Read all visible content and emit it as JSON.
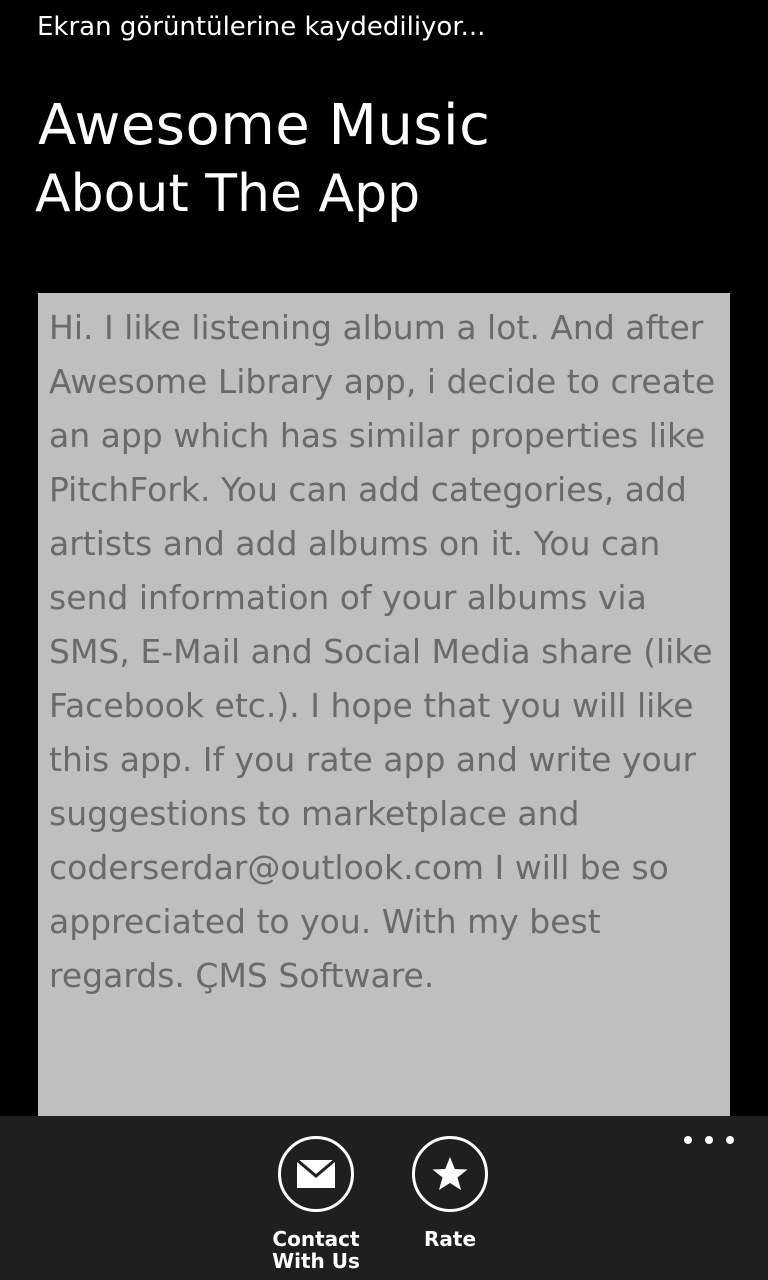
{
  "status_bar": {
    "text": "Ekran görüntülerine kaydediliyor..."
  },
  "header": {
    "app_title": "Awesome Music",
    "page_title": "About The App"
  },
  "about": {
    "text": "Hi. I like listening album a lot. And after Awesome Library app, i decide to create an app which has similar properties like PitchFork. You can add categories, add artists and add albums on it. You can send information of your albums via SMS, E-Mail and Social Media share (like Facebook etc.). I hope that you will like this app. If you rate app and write your suggestions to marketplace and coderserdar@outlook.com I will be so appreciated to you. With my best regards. ÇMS Software."
  },
  "app_bar": {
    "buttons": [
      {
        "label": "Contact\nWith Us",
        "icon": "mail-icon"
      },
      {
        "label": "Rate",
        "icon": "star-icon"
      }
    ],
    "more_icon": "ellipsis-icon"
  },
  "colors": {
    "background": "#000000",
    "text_box_bg": "#bfbfbf",
    "text_box_fg": "#6a6a6a",
    "app_bar_bg": "#1f1f1f"
  }
}
